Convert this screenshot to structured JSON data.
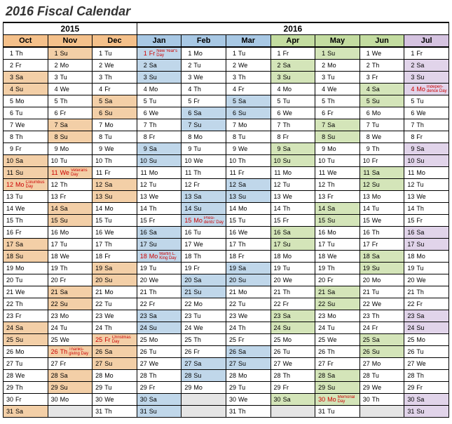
{
  "title": "2016 Fiscal Calendar",
  "years": [
    "2015",
    "2016"
  ],
  "dow": [
    "Su",
    "Mo",
    "Tu",
    "We",
    "Th",
    "Fr",
    "Sa"
  ],
  "holidays": {
    "Oct-12": "Columbus Day",
    "Nov-11": "Veterans Day",
    "Nov-26": "Thanks-giving Day",
    "Dec-25": "Christmas Day",
    "Jan-1": "New Year's Day",
    "Jan-18": "Martin L. King Day",
    "Feb-15": "Presi-dents' Day",
    "May-30": "Memorial Day",
    "Jul-4": "Indepen-dence Day"
  },
  "months": [
    {
      "key": "Oct",
      "label": "Oct",
      "year": 2015,
      "theme": "orange",
      "days": 31,
      "start": 4
    },
    {
      "key": "Nov",
      "label": "Nov",
      "year": 2015,
      "theme": "orange",
      "days": 30,
      "start": 0
    },
    {
      "key": "Dec",
      "label": "Dec",
      "year": 2015,
      "theme": "orange",
      "days": 31,
      "start": 2
    },
    {
      "key": "Jan",
      "label": "Jan",
      "year": 2016,
      "theme": "blue",
      "days": 31,
      "start": 5
    },
    {
      "key": "Feb",
      "label": "Feb",
      "year": 2016,
      "theme": "blue",
      "days": 29,
      "start": 1
    },
    {
      "key": "Mar",
      "label": "Mar",
      "year": 2016,
      "theme": "blue",
      "days": 31,
      "start": 2
    },
    {
      "key": "Apr",
      "label": "Apr",
      "year": 2016,
      "theme": "green",
      "days": 30,
      "start": 5
    },
    {
      "key": "May",
      "label": "May",
      "year": 2016,
      "theme": "green",
      "days": 31,
      "start": 0
    },
    {
      "key": "Jun",
      "label": "Jun",
      "year": 2016,
      "theme": "green",
      "days": 30,
      "start": 3
    },
    {
      "key": "Jul",
      "label": "Jul",
      "year": 2016,
      "theme": "purple",
      "days": 31,
      "start": 5
    }
  ]
}
